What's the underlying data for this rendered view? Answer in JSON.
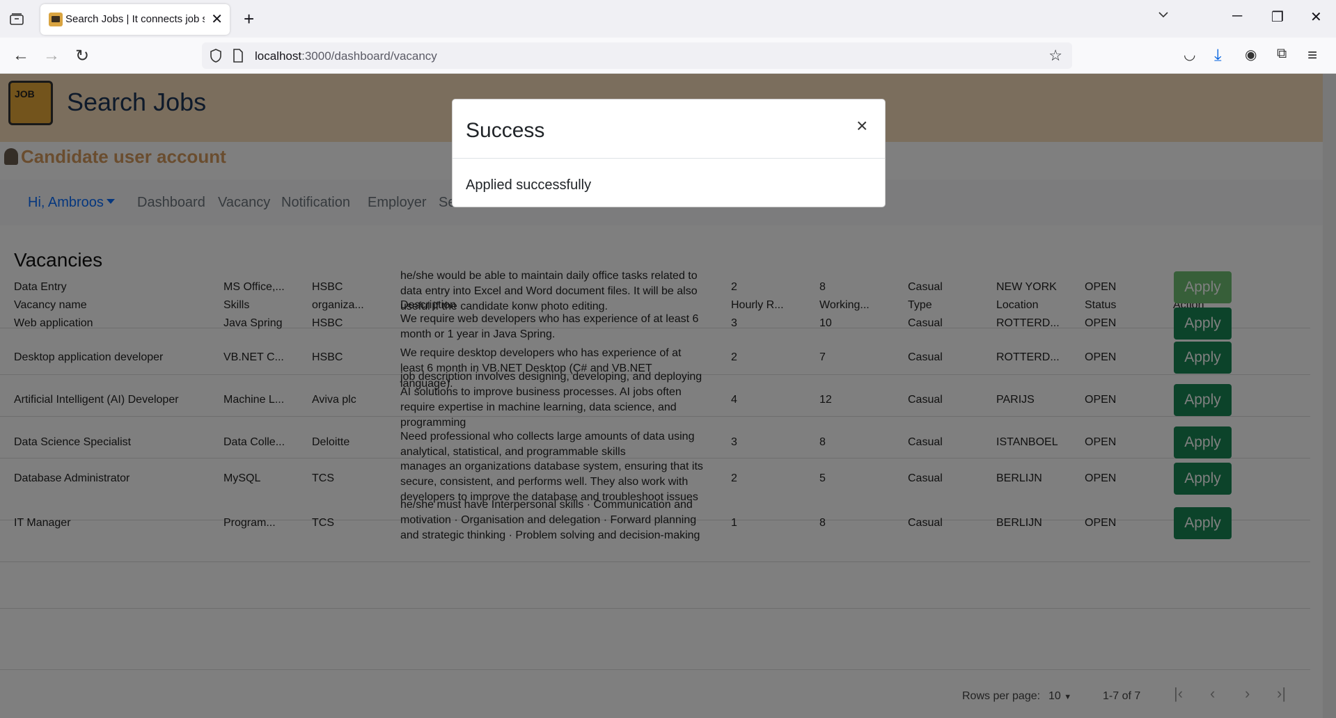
{
  "browser": {
    "tab_title": "Search Jobs | It connects job seekers",
    "url_host": "localhost",
    "url_path": ":3000/dashboard/vacancy"
  },
  "site": {
    "title": "Search Jobs",
    "logo_text": "JOB",
    "account_label": "Candidate user account"
  },
  "menu": {
    "user": "Hi, Ambroos",
    "items": [
      "Dashboard",
      "Vacancy",
      "Notification",
      "Employer",
      "Se"
    ]
  },
  "vacancies": {
    "title": "Vacancies",
    "headers": [
      "Vacancy name",
      "Skills",
      "organiza...",
      "Description",
      "Hourly R...",
      "Working...",
      "Type",
      "Location",
      "Status",
      "Action"
    ],
    "rows": [
      {
        "name": "Data Entry",
        "skills": "MS Office,...",
        "org": "HSBC",
        "desc": "he/she would be able to maintain daily office tasks related to data entry into Excel and Word document files. It will be also useful if the candidate konw photo editing.",
        "rate": "2",
        "hours": "8",
        "type": "Casual",
        "location": "NEW YORK",
        "status": "OPEN",
        "action": "Apply"
      },
      {
        "name": "Web application",
        "skills": "Java Spring",
        "org": "HSBC",
        "desc": "We require web developers who has experience of at least 6 month or 1 year in Java Spring.",
        "rate": "3",
        "hours": "10",
        "type": "Casual",
        "location": "ROTTERD...",
        "status": "OPEN",
        "action": "Apply"
      },
      {
        "name": "Desktop application developer",
        "skills": "VB.NET C...",
        "org": "HSBC",
        "desc": "We require desktop developers who has experience of at least 6 month in VB.NET Desktop (C# and VB.NET language).",
        "rate": "2",
        "hours": "7",
        "type": "Casual",
        "location": "ROTTERD...",
        "status": "OPEN",
        "action": "Apply"
      },
      {
        "name": "Artificial Intelligent (AI) Developer",
        "skills": "Machine L...",
        "org": "Aviva plc",
        "desc": "job description involves designing, developing, and deploying AI solutions to improve business processes. AI jobs often require expertise in machine learning, data science, and programming",
        "rate": "4",
        "hours": "12",
        "type": "Casual",
        "location": "PARIJS",
        "status": "OPEN",
        "action": "Apply"
      },
      {
        "name": "Data Science Specialist",
        "skills": "Data Colle...",
        "org": "Deloitte",
        "desc": "Need professional who collects large amounts of data using analytical, statistical, and programmable skills",
        "rate": "3",
        "hours": "8",
        "type": "Casual",
        "location": "ISTANBOEL",
        "status": "OPEN",
        "action": "Apply"
      },
      {
        "name": "Database Administrator",
        "skills": "MySQL",
        "org": "TCS",
        "desc": "manages an organizations database system, ensuring that its secure, consistent, and performs well. They also work with developers to improve the database and troubleshoot issues",
        "rate": "2",
        "hours": "5",
        "type": "Casual",
        "location": "BERLIJN",
        "status": "OPEN",
        "action": "Apply"
      },
      {
        "name": "IT Manager",
        "skills": "Program...",
        "org": "TCS",
        "desc": "he/she must have Interpersonal skills · Communication and motivation · Organisation and delegation · Forward planning and strategic thinking · Problem solving and decision-making",
        "rate": "1",
        "hours": "8",
        "type": "Casual",
        "location": "BERLIJN",
        "status": "OPEN",
        "action": "Apply"
      }
    ],
    "rows_per_page_label": "Rows per page:",
    "rows_per_page": "10",
    "range": "1-7 of 7"
  },
  "modal": {
    "title": "Success",
    "body": "Applied successfully",
    "close": "×"
  }
}
